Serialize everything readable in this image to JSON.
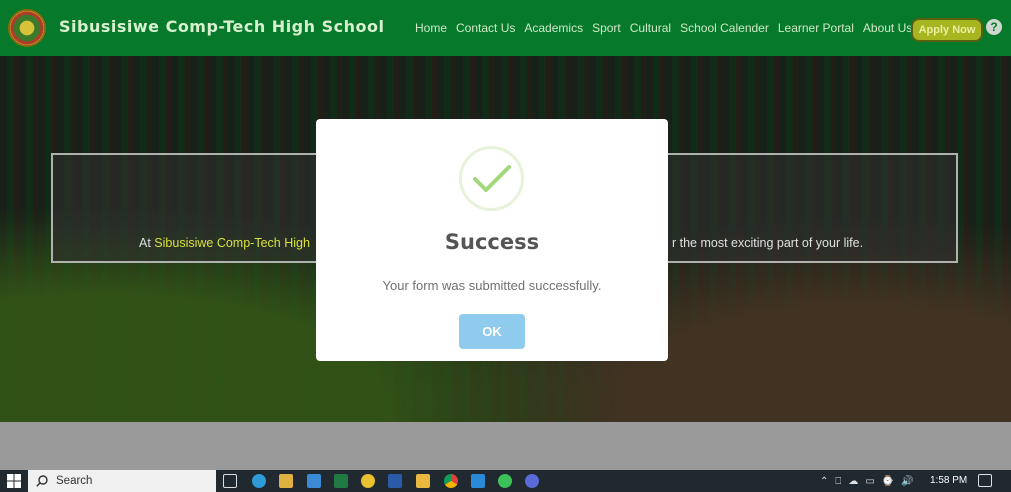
{
  "header": {
    "school_name": "Sibusisiwe Comp-Tech High School",
    "nav": [
      "Home",
      "Contact Us",
      "Academics",
      "Sport",
      "Cultural",
      "School Calender",
      "Learner Portal",
      "About Us"
    ],
    "apply_label": "Apply Now",
    "help_label": "?"
  },
  "hero": {
    "text_prefix": "At ",
    "text_school": "Sibusisiwe Comp-Tech High",
    "text_suffix": "r the most exciting part of your life."
  },
  "modal": {
    "title": "Success",
    "message": "Your form was submitted successfully.",
    "ok_label": "OK"
  },
  "taskbar": {
    "search_label": "Search",
    "time": "1:58 PM"
  },
  "colors": {
    "header_bg": "#067a2a",
    "apply_bg": "#a7b520",
    "ok_bg": "#8ecbec",
    "check": "#a0d87a"
  },
  "icons": [
    "windows-start-icon",
    "search-icon",
    "task-view-icon",
    "edge-icon",
    "store-icon",
    "mail-icon",
    "excel-icon",
    "app-icon",
    "word-icon",
    "file-explorer-icon",
    "chrome-icon",
    "vscode-icon",
    "whatsapp-icon",
    "app-icon-2",
    "chevron-up-icon",
    "network-icon",
    "cloud-icon",
    "battery-icon",
    "wifi-icon",
    "volume-icon",
    "notification-icon"
  ]
}
